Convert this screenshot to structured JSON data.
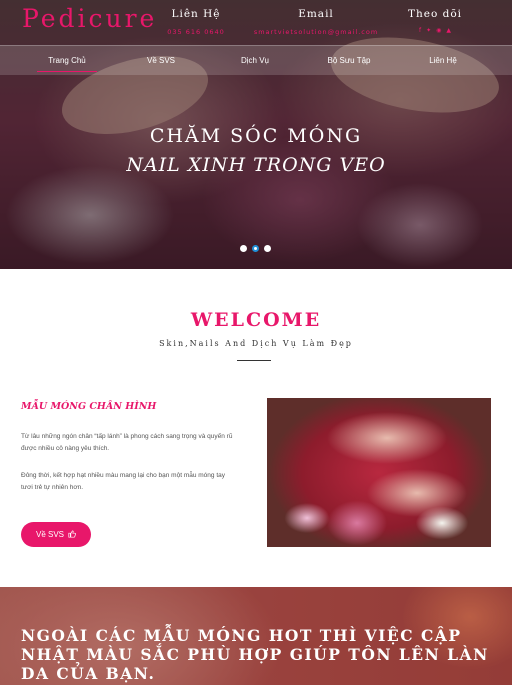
{
  "header": {
    "brand": "Pedicure",
    "contact": {
      "title": "Liên Hệ",
      "value": "035 616 0640"
    },
    "email": {
      "title": "Email",
      "value": "smartvietsolution@gmail.com"
    },
    "follow": {
      "title": "Theo dõi",
      "icons": [
        "facebook-icon",
        "twitter-icon",
        "rss-icon",
        "vk-icon"
      ]
    }
  },
  "nav": {
    "items": [
      {
        "label": "Trang Chủ",
        "active": true
      },
      {
        "label": "Về SVS",
        "active": false
      },
      {
        "label": "Dịch Vụ",
        "active": false
      },
      {
        "label": "Bộ Sưu Tập",
        "active": false
      },
      {
        "label": "Liên Hệ",
        "active": false
      }
    ]
  },
  "hero": {
    "title": "CHĂM SÓC MÓNG",
    "subtitle": "NAIL XINH TRONG VEO",
    "slides_count": 3,
    "active_slide": 2
  },
  "welcome": {
    "title": "WELCOME",
    "subtitle": "Skin,Nails And Dịch Vụ Làm Đẹp"
  },
  "article": {
    "title": "MẪU MÓNG CHÂN HÌNH",
    "paragraphs": [
      "Từ lâu những ngón chân “tấp lánh” là phong cách sang trọng và quyến rũ được nhiều cô nàng yêu thích.",
      "Đông thời, kết hợp hạt nhiều màu mang lại cho bạn một mẫu móng tay tươi trẻ tự nhiên hơn."
    ],
    "button_label": "Về SVS",
    "button_icon": "thumbs-up-icon"
  },
  "banner": {
    "text": "NGOÀI CÁC MẪU MÓNG HOT THÌ VIỆC CẬP NHẬT MÀU SẮC PHÙ HỢP GIÚP TÔN LÊN LÀN DA CỦA BẠN."
  },
  "colors": {
    "accent": "#e8176a",
    "dot_active": "#1f8fd6"
  }
}
